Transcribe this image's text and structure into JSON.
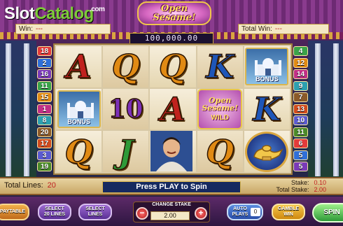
{
  "brand": {
    "part1": "Slot",
    "part2": "Catalog",
    "suffix": ".com"
  },
  "game": {
    "logo_line1": "Open",
    "logo_line2": "Sesame!"
  },
  "header": {
    "win_label": "Win:",
    "win_value": "---",
    "total_win_label": "Total Win:",
    "total_win_value": "---",
    "jackpot": "100,000.00"
  },
  "paylines_left": [
    "18",
    "2",
    "16",
    "11",
    "15",
    "1",
    "8",
    "20",
    "17",
    "3",
    "19"
  ],
  "paylines_right": [
    "4",
    "12",
    "14",
    "9",
    "7",
    "13",
    "10",
    "11",
    "6",
    "5",
    "5"
  ],
  "reels": [
    [
      {
        "type": "letter",
        "text": "A",
        "color": "red"
      },
      {
        "type": "letter",
        "text": "Q",
        "color": "orange"
      },
      {
        "type": "letter",
        "text": "Q",
        "color": "orange"
      },
      {
        "type": "letter",
        "text": "K",
        "color": "blue"
      },
      {
        "type": "scatter",
        "tag": "BONUS"
      }
    ],
    [
      {
        "type": "scatter",
        "tag": "BONUS"
      },
      {
        "type": "letter",
        "text": "10",
        "color": "purple"
      },
      {
        "type": "letter",
        "text": "A",
        "color": "red"
      },
      {
        "type": "wild",
        "line1": "Open",
        "line2": "Sesame!",
        "tag": "WILD"
      },
      {
        "type": "letter",
        "text": "K",
        "color": "blue"
      }
    ],
    [
      {
        "type": "letter",
        "text": "Q",
        "color": "orange"
      },
      {
        "type": "letter",
        "text": "J",
        "color": "green"
      },
      {
        "type": "prince"
      },
      {
        "type": "letter",
        "text": "Q",
        "color": "orange"
      },
      {
        "type": "lamp"
      }
    ]
  ],
  "footer": {
    "total_lines_label": "Total Lines:",
    "total_lines_value": "20",
    "message": "Press PLAY to Spin",
    "stake_label": "Stake:",
    "stake_value": "0.10",
    "total_stake_label": "Total Stake:",
    "total_stake_value": "2.00"
  },
  "controls": {
    "paytable": "PAYTABLE",
    "select20_1": "SELECT",
    "select20_2": "20 LINES",
    "select_1": "SELECT",
    "select_2": "LINES",
    "change_stake": "CHANGE STAKE",
    "stake_display": "2.00",
    "minus": "−",
    "plus": "+",
    "auto_1": "AUTO",
    "auto_2": "PLAYS",
    "auto_count": "0",
    "gamble_1": "GAMBLE",
    "gamble_2": "WIN",
    "spin": "SPIN"
  },
  "colors": {
    "red": "#c0221e",
    "orange": "#e08a14",
    "purple": "#7b2fb8",
    "blue": "#1e56b8",
    "green": "#2e9a38",
    "badge_palette": [
      "#e23b3b",
      "#2f6fd8",
      "#7a3ab8",
      "#3aa34a",
      "#e08a14",
      "#c02f86",
      "#2c9fb0",
      "#8a5a2a",
      "#d04a1e",
      "#5a5ad0",
      "#4a8a2a"
    ]
  }
}
